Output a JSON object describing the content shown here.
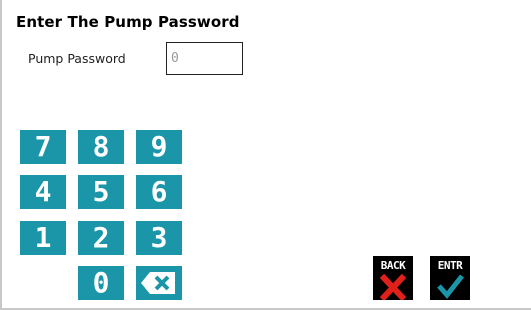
{
  "screen": {
    "title": "Enter The Pump Password"
  },
  "password_field": {
    "label": "Pump Password",
    "value": "0"
  },
  "keypad": {
    "keys": [
      "7",
      "8",
      "9",
      "4",
      "5",
      "6",
      "1",
      "2",
      "3",
      "0"
    ],
    "backspace_icon": "backspace-icon",
    "key_color": "#1a96a8"
  },
  "actions": {
    "back_label": "BACK",
    "enter_label": "ENTR",
    "back_icon": "red-x-icon",
    "enter_icon": "check-icon",
    "back_icon_color": "#e0211b",
    "enter_icon_color": "#1a96a8"
  }
}
